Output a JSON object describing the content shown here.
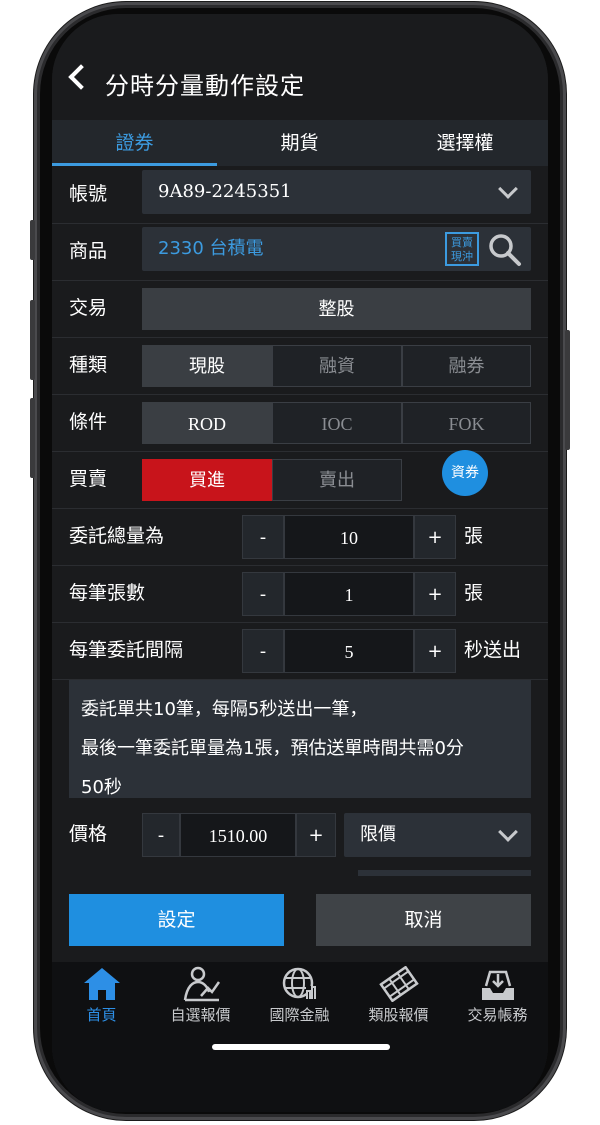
{
  "header": {
    "title": "分時分量動作設定"
  },
  "tabs": [
    "證券",
    "期貨",
    "選擇權"
  ],
  "form": {
    "account": {
      "label": "帳號",
      "value": "9A89-2245351"
    },
    "product": {
      "label": "商品",
      "value": "2330 台積電",
      "badge": "買賣\n現沖"
    },
    "trade": {
      "label": "交易",
      "value": "整股"
    },
    "kind": {
      "label": "種類",
      "options": [
        "現股",
        "融資",
        "融券"
      ]
    },
    "condition": {
      "label": "條件",
      "options": [
        "ROD",
        "IOC",
        "FOK"
      ]
    },
    "side": {
      "label": "買賣",
      "options": [
        "買進",
        "賣出"
      ],
      "extra": "資券"
    },
    "total": {
      "label": "委託總量為",
      "minus": "-",
      "value": "10",
      "plus": "+",
      "unit": "張"
    },
    "per": {
      "label": "每筆張數",
      "minus": "-",
      "value": "1",
      "plus": "+",
      "unit": "張"
    },
    "interval": {
      "label": "每筆委託間隔",
      "minus": "-",
      "value": "5",
      "plus": "+",
      "unit": "秒送出"
    },
    "summary": [
      "委託單共10筆，每隔5秒送出一筆，",
      "最後一筆委託單量為1張，預估送單時間共需0分",
      "50秒"
    ],
    "price": {
      "label": "價格",
      "minus": "-",
      "value": "1510.00",
      "plus": "+",
      "type": "限價"
    }
  },
  "actions": {
    "set": "設定",
    "cancel": "取消"
  },
  "nav": [
    {
      "label": "首頁",
      "icon": "home-icon"
    },
    {
      "label": "自選報價",
      "icon": "user-chart-icon"
    },
    {
      "label": "國際金融",
      "icon": "globe-icon"
    },
    {
      "label": "類股報價",
      "icon": "film-icon"
    },
    {
      "label": "交易帳務",
      "icon": "tray-icon"
    }
  ]
}
